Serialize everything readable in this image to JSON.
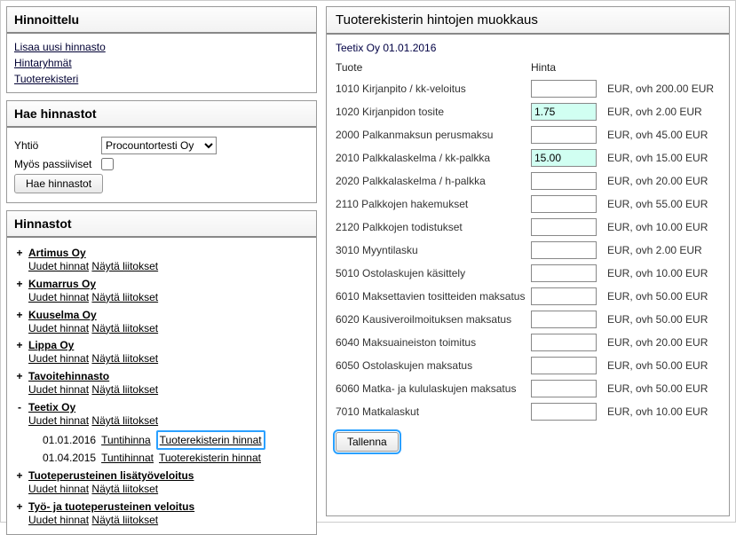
{
  "left": {
    "pricing": {
      "title": "Hinnoittelu",
      "links": [
        "Lisaa uusi hinnasto",
        "Hintaryhmät",
        "Tuoterekisteri"
      ]
    },
    "search": {
      "title": "Hae hinnastot",
      "company_label": "Yhtiö",
      "company_value": "Procountortesti Oy",
      "passive_label": "Myös passiiviset",
      "button": "Hae hinnastot"
    },
    "pricelists": {
      "title": "Hinnastot",
      "new_prices": "Uudet hinnat",
      "show_att": "Näytä liitokset",
      "items": [
        {
          "name": "Artimus Oy",
          "expanded": false
        },
        {
          "name": "Kumarrus Oy",
          "expanded": false
        },
        {
          "name": "Kuuselma Oy",
          "expanded": false
        },
        {
          "name": "Lippa Oy",
          "expanded": false
        },
        {
          "name": "Tavoitehinnasto",
          "expanded": false
        },
        {
          "name": "Teetix Oy",
          "expanded": true,
          "rows": [
            {
              "date": "01.01.2016",
              "l1": "Tuntihinna",
              "l2": "Tuoterekisterin hinnat",
              "hl": true
            },
            {
              "date": "01.04.2015",
              "l1": "Tuntihinnat",
              "l2": "Tuoterekisterin hinnat",
              "hl": false
            }
          ]
        },
        {
          "name": "Tuoteperusteinen lisätyöveloitus",
          "expanded": false
        },
        {
          "name": "Työ- ja tuoteperusteinen veloitus",
          "expanded": false
        }
      ]
    }
  },
  "right": {
    "title": "Tuoterekisterin hintojen muokkaus",
    "subtitle": "Teetix Oy 01.01.2016",
    "col_product": "Tuote",
    "col_price": "Hinta",
    "save": "Tallenna",
    "rows": [
      {
        "name": "1010 Kirjanpito / kk-veloitus",
        "value": "",
        "suffix": "EUR, ovh 200.00 EUR",
        "hl": false
      },
      {
        "name": "1020 Kirjanpidon tosite",
        "value": "1.75",
        "suffix": "EUR, ovh 2.00 EUR",
        "hl": true
      },
      {
        "name": "2000 Palkanmaksun perusmaksu",
        "value": "",
        "suffix": "EUR, ovh 45.00 EUR",
        "hl": false
      },
      {
        "name": "2010 Palkkalaskelma / kk-palkka",
        "value": "15.00",
        "suffix": "EUR, ovh 15.00 EUR",
        "hl": true
      },
      {
        "name": "2020 Palkkalaskelma / h-palkka",
        "value": "",
        "suffix": "EUR, ovh 20.00 EUR",
        "hl": false
      },
      {
        "name": "2110 Palkkojen hakemukset",
        "value": "",
        "suffix": "EUR, ovh 55.00 EUR",
        "hl": false
      },
      {
        "name": "2120 Palkkojen todistukset",
        "value": "",
        "suffix": "EUR, ovh 10.00 EUR",
        "hl": false
      },
      {
        "name": "3010 Myyntilasku",
        "value": "",
        "suffix": "EUR, ovh 2.00 EUR",
        "hl": false
      },
      {
        "name": "5010 Ostolaskujen käsittely",
        "value": "",
        "suffix": "EUR, ovh 10.00 EUR",
        "hl": false
      },
      {
        "name": "6010 Maksettavien tositteiden maksatus",
        "value": "",
        "suffix": "EUR, ovh 50.00 EUR",
        "hl": false
      },
      {
        "name": "6020 Kausiveroilmoituksen maksatus",
        "value": "",
        "suffix": "EUR, ovh 50.00 EUR",
        "hl": false
      },
      {
        "name": "6040 Maksuaineiston toimitus",
        "value": "",
        "suffix": "EUR, ovh 20.00 EUR",
        "hl": false
      },
      {
        "name": "6050 Ostolaskujen maksatus",
        "value": "",
        "suffix": "EUR, ovh 50.00 EUR",
        "hl": false
      },
      {
        "name": "6060 Matka- ja kululaskujen maksatus",
        "value": "",
        "suffix": "EUR, ovh 50.00 EUR",
        "hl": false
      },
      {
        "name": "7010 Matkalaskut",
        "value": "",
        "suffix": "EUR, ovh 10.00 EUR",
        "hl": false
      }
    ]
  }
}
